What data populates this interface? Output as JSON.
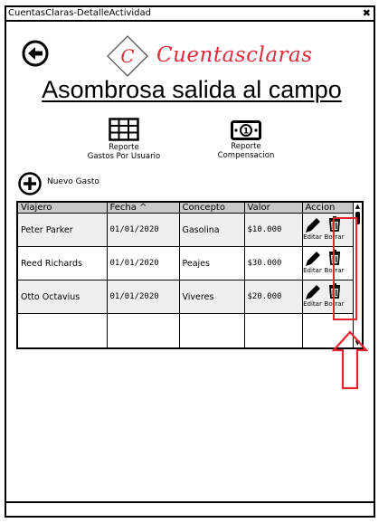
{
  "window": {
    "title": "CuentasClaras-DetalleActividad",
    "close_label": "✖"
  },
  "brand": {
    "logo_letter": "C",
    "name": "Cuentasclaras",
    "color": "#e12a3a"
  },
  "page": {
    "title": "Asombrosa salida al campo"
  },
  "reports": [
    {
      "label_line1": "Reporte",
      "label_line2": "Gastos Por Usuario",
      "icon": "table-icon"
    },
    {
      "label_line1": "Reporte",
      "label_line2": "Compensacion",
      "icon": "money-icon"
    }
  ],
  "add_expense": {
    "label": "Nuevo Gasto",
    "icon": "plus-circle-icon"
  },
  "table": {
    "columns": [
      "Viajero",
      "Fecha ^",
      "Concepto",
      "Valor",
      "Accion"
    ],
    "rows": [
      {
        "traveler": "Peter Parker",
        "date": "01/01/2020",
        "concept": "Gasolina",
        "value": "$10.000",
        "edit_label": "Editar",
        "delete_label": "Borrar"
      },
      {
        "traveler": "Reed Richards",
        "date": "01/01/2020",
        "concept": "Peajes",
        "value": "$30.000",
        "edit_label": "Editar",
        "delete_label": "Borrar"
      },
      {
        "traveler": "Otto Octavius",
        "date": "01/01/2020",
        "concept": "Viveres",
        "value": "$20.000",
        "edit_label": "Editar",
        "delete_label": "Borrar"
      }
    ]
  },
  "annotation": {
    "color": "#e3242b"
  }
}
